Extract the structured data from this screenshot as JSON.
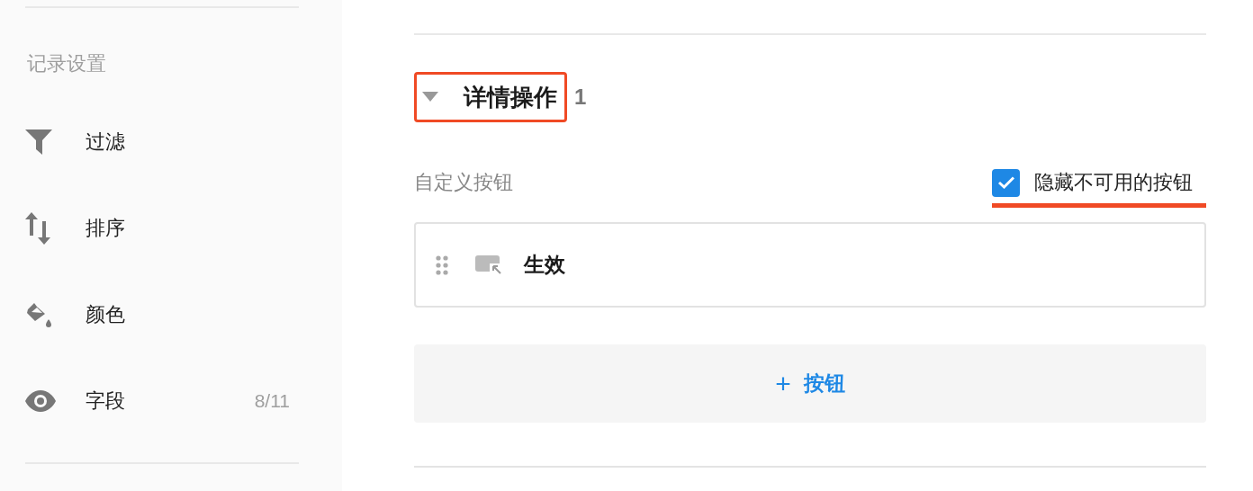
{
  "sidebar": {
    "section_title": "记录设置",
    "items": [
      {
        "kind": "filter",
        "label": "过滤"
      },
      {
        "kind": "sort",
        "label": "排序"
      },
      {
        "kind": "color",
        "label": "颜色"
      },
      {
        "kind": "fields",
        "label": "字段",
        "count": "8/11"
      }
    ]
  },
  "section": {
    "title": "详情操作",
    "count": "1",
    "expanded": true,
    "label": "自定义按钮",
    "hide_unavailable": {
      "label": "隐藏不可用的按钮",
      "checked": true
    },
    "buttons": [
      {
        "label": "生效"
      }
    ],
    "add_button": {
      "icon": "+",
      "label": "按钮"
    }
  }
}
